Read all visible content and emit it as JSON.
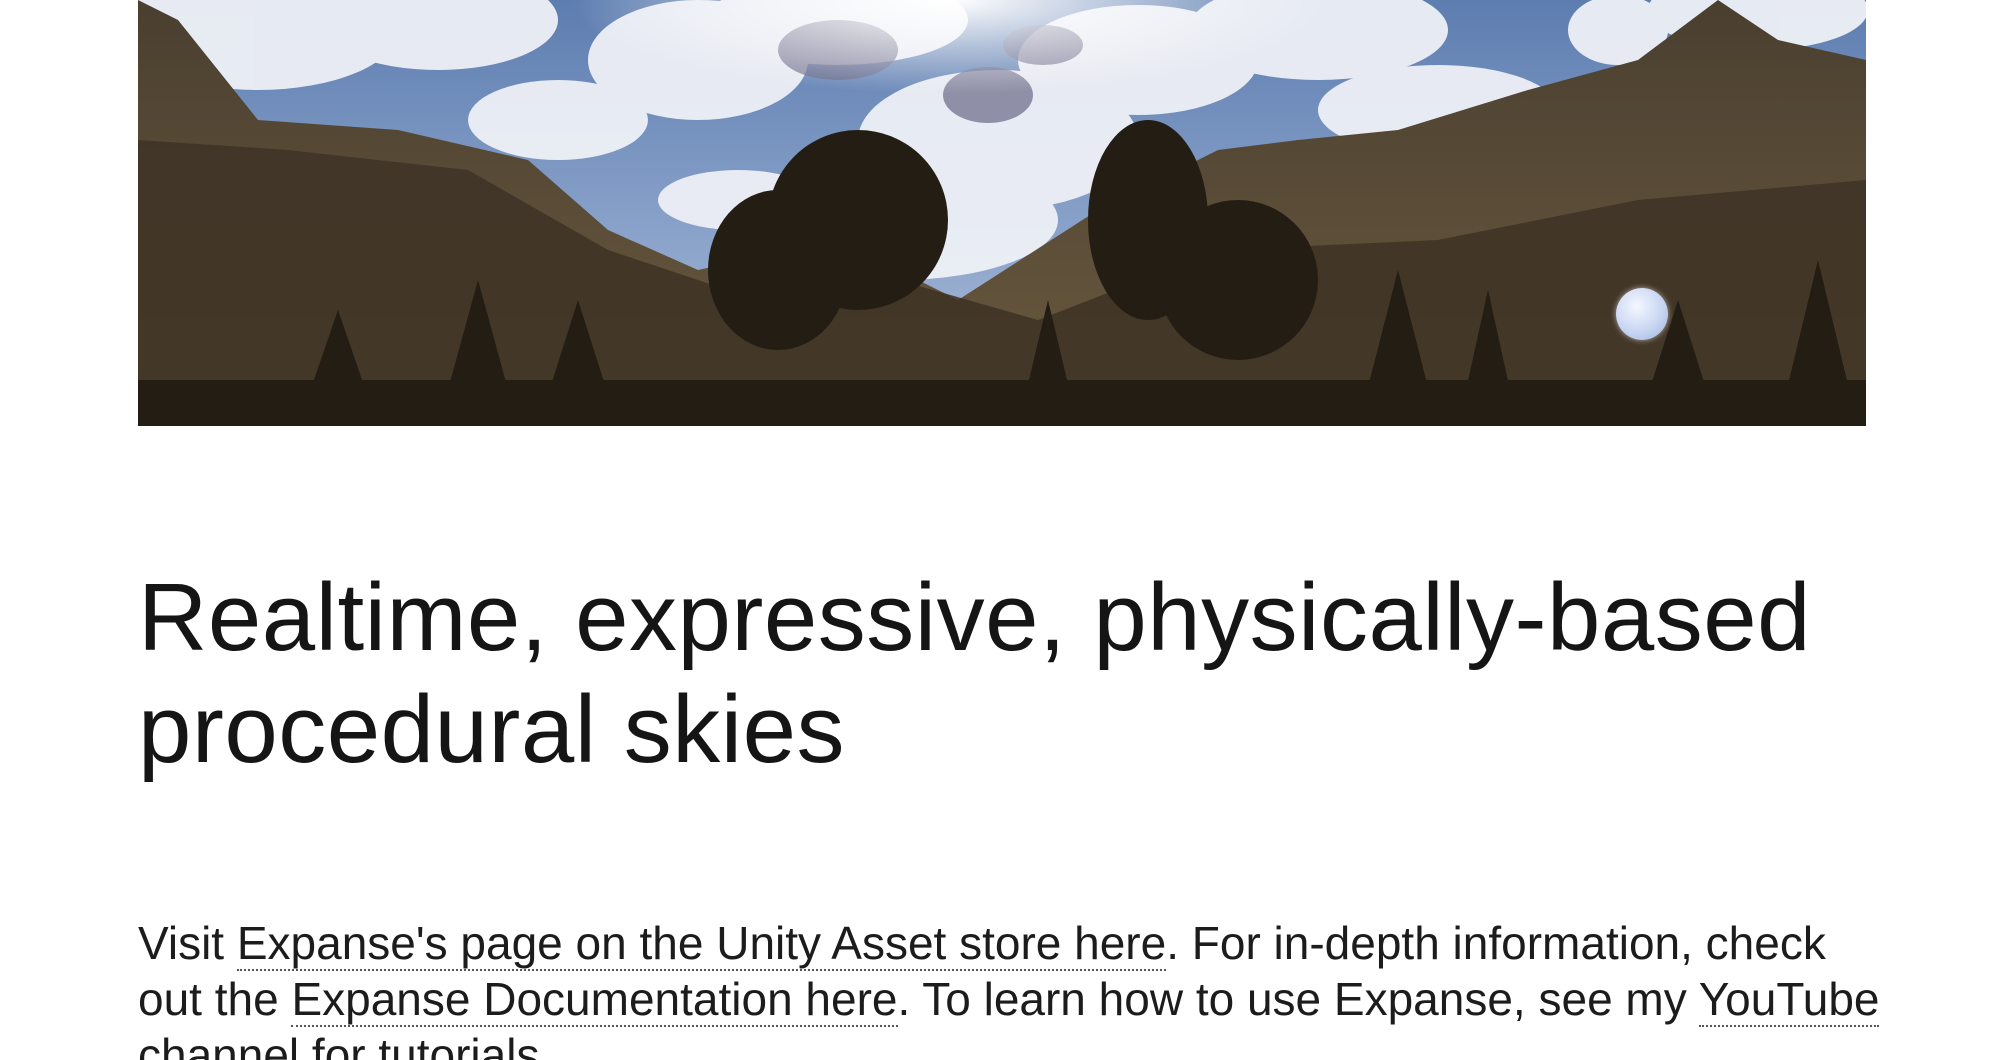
{
  "hero": {
    "image_name": "mountain-sky-landscape",
    "moon_icon": "moon-icon"
  },
  "headline": {
    "line1": "Realtime, expressive, physically-based",
    "line2": "procedural skies"
  },
  "intro": {
    "visit_text": "Visit ",
    "asset_store_link": "Expanse's page on the Unity Asset store here",
    "after_store_text": ". For in-depth information, check out the ",
    "docs_link": "Expanse Documentation here",
    "after_docs_text": ". To learn how to use Expanse, see my ",
    "youtube_link": "YouTube channel for tutorials",
    "end_text": "."
  },
  "colors": {
    "text": "#141414",
    "background": "#ffffff",
    "sky": "#6a86b4"
  }
}
